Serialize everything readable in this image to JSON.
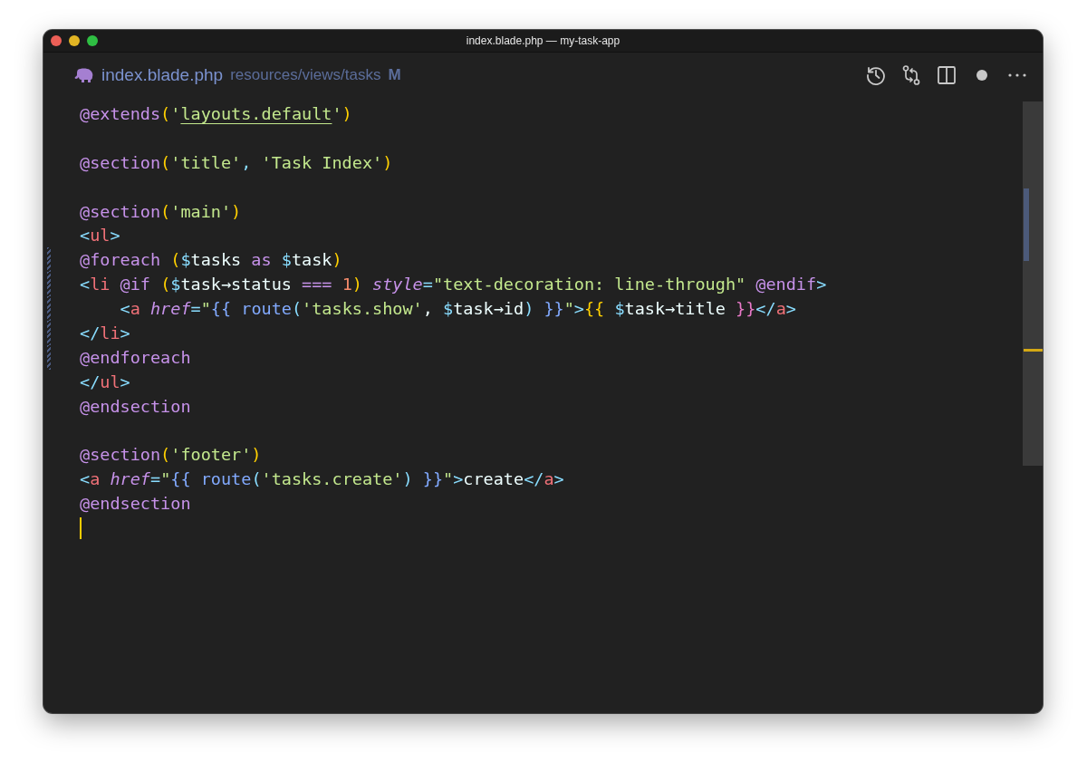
{
  "window": {
    "title": "index.blade.php — my-task-app"
  },
  "tab": {
    "filename": "index.blade.php",
    "path": "resources/views/tasks",
    "git_status": "M"
  },
  "code_lines": [
    {
      "kind": "code",
      "tokens": [
        {
          "kind": "directive",
          "text": "@extends"
        },
        {
          "kind": "paren",
          "text": "("
        },
        {
          "kind": "string",
          "text": "'"
        },
        {
          "kind": "link",
          "text": "layouts.default"
        },
        {
          "kind": "string",
          "text": "'"
        },
        {
          "kind": "paren",
          "text": ")"
        }
      ]
    },
    {
      "kind": "blank"
    },
    {
      "kind": "code",
      "tokens": [
        {
          "kind": "directive",
          "text": "@section"
        },
        {
          "kind": "paren",
          "text": "("
        },
        {
          "kind": "string",
          "text": "'title'"
        },
        {
          "kind": "punct",
          "text": ", "
        },
        {
          "kind": "string",
          "text": "'Task Index'"
        },
        {
          "kind": "paren",
          "text": ")"
        }
      ]
    },
    {
      "kind": "blank"
    },
    {
      "kind": "code",
      "tokens": [
        {
          "kind": "directive",
          "text": "@section"
        },
        {
          "kind": "paren",
          "text": "("
        },
        {
          "kind": "string",
          "text": "'main'"
        },
        {
          "kind": "paren",
          "text": ")"
        }
      ]
    },
    {
      "kind": "code",
      "tokens": [
        {
          "kind": "punct",
          "text": "<"
        },
        {
          "kind": "tag",
          "text": "ul"
        },
        {
          "kind": "punct",
          "text": ">"
        }
      ]
    },
    {
      "kind": "code",
      "modified": true,
      "tokens": [
        {
          "kind": "directive",
          "text": "@foreach "
        },
        {
          "kind": "paren",
          "text": "("
        },
        {
          "kind": "var",
          "text": "$"
        },
        {
          "kind": "plain",
          "text": "tasks "
        },
        {
          "kind": "keyword",
          "text": "as "
        },
        {
          "kind": "var",
          "text": "$"
        },
        {
          "kind": "plain",
          "text": "task"
        },
        {
          "kind": "paren",
          "text": ")"
        }
      ]
    },
    {
      "kind": "code",
      "modified": true,
      "tokens": [
        {
          "kind": "punct",
          "text": "<"
        },
        {
          "kind": "tag",
          "text": "li "
        },
        {
          "kind": "directive",
          "text": "@if "
        },
        {
          "kind": "paren",
          "text": "("
        },
        {
          "kind": "var",
          "text": "$"
        },
        {
          "kind": "plain",
          "text": "task→status "
        },
        {
          "kind": "keyword",
          "text": "=== "
        },
        {
          "kind": "number",
          "text": "1"
        },
        {
          "kind": "paren",
          "text": ") "
        },
        {
          "kind": "attr",
          "text": "style"
        },
        {
          "kind": "punct",
          "text": "="
        },
        {
          "kind": "string",
          "text": "\"text-decoration: line-through\" "
        },
        {
          "kind": "directive",
          "text": "@endif"
        },
        {
          "kind": "punct",
          "text": ">"
        }
      ]
    },
    {
      "kind": "code",
      "modified": true,
      "tokens": [
        {
          "kind": "punct",
          "text": "    <"
        },
        {
          "kind": "tag",
          "text": "a "
        },
        {
          "kind": "attr",
          "text": "href"
        },
        {
          "kind": "punct",
          "text": "="
        },
        {
          "kind": "string",
          "text": "\""
        },
        {
          "kind": "brace",
          "text": "{{ "
        },
        {
          "kind": "func",
          "text": "route"
        },
        {
          "kind": "punct",
          "text": "("
        },
        {
          "kind": "string",
          "text": "'tasks.show'"
        },
        {
          "kind": "plain",
          "text": ", "
        },
        {
          "kind": "var",
          "text": "$"
        },
        {
          "kind": "plain",
          "text": "task→id"
        },
        {
          "kind": "punct",
          "text": ") "
        },
        {
          "kind": "brace",
          "text": "}}"
        },
        {
          "kind": "string",
          "text": "\""
        },
        {
          "kind": "punct",
          "text": ">"
        },
        {
          "kind": "paren",
          "text": "{{ "
        },
        {
          "kind": "var",
          "text": "$"
        },
        {
          "kind": "plain",
          "text": "task→title "
        },
        {
          "kind": "brace2",
          "text": "}}"
        },
        {
          "kind": "punct",
          "text": "</"
        },
        {
          "kind": "tag",
          "text": "a"
        },
        {
          "kind": "punct",
          "text": ">"
        }
      ]
    },
    {
      "kind": "code",
      "modified": true,
      "tokens": [
        {
          "kind": "punct",
          "text": "</"
        },
        {
          "kind": "tag",
          "text": "li"
        },
        {
          "kind": "punct",
          "text": ">"
        }
      ]
    },
    {
      "kind": "code",
      "modified": true,
      "tokens": [
        {
          "kind": "directive",
          "text": "@endforeach"
        }
      ]
    },
    {
      "kind": "code",
      "tokens": [
        {
          "kind": "punct",
          "text": "</"
        },
        {
          "kind": "tag",
          "text": "ul"
        },
        {
          "kind": "punct",
          "text": ">"
        }
      ]
    },
    {
      "kind": "code",
      "tokens": [
        {
          "kind": "directive",
          "text": "@endsection"
        }
      ]
    },
    {
      "kind": "blank"
    },
    {
      "kind": "code",
      "tokens": [
        {
          "kind": "directive",
          "text": "@section"
        },
        {
          "kind": "paren",
          "text": "("
        },
        {
          "kind": "string",
          "text": "'footer'"
        },
        {
          "kind": "paren",
          "text": ")"
        }
      ]
    },
    {
      "kind": "code",
      "tokens": [
        {
          "kind": "punct",
          "text": "<"
        },
        {
          "kind": "tag",
          "text": "a "
        },
        {
          "kind": "attr",
          "text": "href"
        },
        {
          "kind": "punct",
          "text": "="
        },
        {
          "kind": "string",
          "text": "\""
        },
        {
          "kind": "brace",
          "text": "{{ "
        },
        {
          "kind": "func",
          "text": "route"
        },
        {
          "kind": "punct",
          "text": "("
        },
        {
          "kind": "string",
          "text": "'tasks.create'"
        },
        {
          "kind": "punct",
          "text": ") "
        },
        {
          "kind": "brace",
          "text": "}}"
        },
        {
          "kind": "string",
          "text": "\""
        },
        {
          "kind": "punct",
          "text": ">"
        },
        {
          "kind": "plain",
          "text": "create"
        },
        {
          "kind": "punct",
          "text": "</"
        },
        {
          "kind": "tag",
          "text": "a"
        },
        {
          "kind": "punct",
          "text": ">"
        }
      ]
    },
    {
      "kind": "code",
      "tokens": [
        {
          "kind": "directive",
          "text": "@endsection"
        }
      ]
    },
    {
      "kind": "cursor"
    }
  ]
}
